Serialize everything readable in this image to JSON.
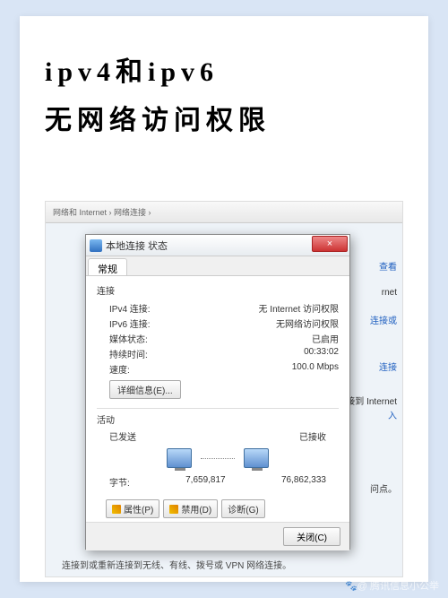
{
  "article": {
    "title_line1": "ipv4和ipv6",
    "title_line2": "无网络访问权限"
  },
  "background": {
    "toolbar_hint": "网络和 Internet › 网络连接 ›",
    "link_view": "查看",
    "link_internet": "rnet",
    "link_conn": "连接或",
    "link_conn2": "连接",
    "link_conn3": "连接到 Internet",
    "link_join": "入",
    "link_dot": "问点。",
    "bottom_text": "连接到或重新连接到无线、有线、拨号或 VPN 网络连接。"
  },
  "dialog": {
    "title": "本地连接 状态",
    "close_label": "×",
    "tabs": {
      "general": "常规"
    },
    "connection": {
      "header": "连接",
      "ipv4_label": "IPv4 连接:",
      "ipv4_value": "无 Internet 访问权限",
      "ipv6_label": "IPv6 连接:",
      "ipv6_value": "无网络访问权限",
      "media_label": "媒体状态:",
      "media_value": "已启用",
      "duration_label": "持续时间:",
      "duration_value": "00:33:02",
      "speed_label": "速度:",
      "speed_value": "100.0 Mbps",
      "details_btn": "详细信息(E)..."
    },
    "activity": {
      "header": "活动",
      "sent_label": "已发送",
      "recv_label": "已接收",
      "bytes_label": "字节:",
      "bytes_sent": "7,659,817",
      "bytes_recv": "76,862,333"
    },
    "buttons": {
      "properties": "属性(P)",
      "disable": "禁用(D)",
      "diagnose": "诊断(G)",
      "close": "关闭(C)"
    }
  },
  "watermark": "🐾@ 腾讯信息小公举"
}
